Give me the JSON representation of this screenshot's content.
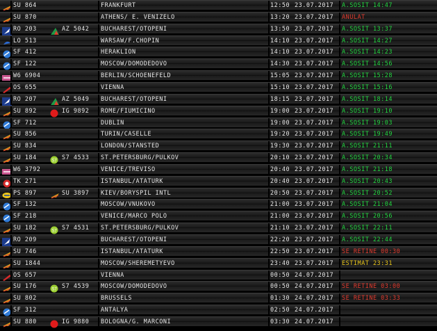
{
  "colors": {
    "status_ok": "#22d640",
    "status_cancel": "#e23b2f",
    "status_delayed": "#e23b2f",
    "status_estimate": "#e7c41a",
    "text": "#e9e9e9"
  },
  "flights": [
    {
      "airline_logo": "aeroflot-icon",
      "code": "SU 864",
      "cs_logo": "",
      "cs_code": "",
      "dest": "FRANKFURT",
      "time": "12:50",
      "date": "23.07.2017",
      "status": "A.SOSIT 14:47",
      "status_type": "ok"
    },
    {
      "airline_logo": "aeroflot-icon",
      "code": "SU 870",
      "cs_logo": "",
      "cs_code": "",
      "dest": "ATHENS/ E. VENIZELO",
      "time": "13:20",
      "date": "23.07.2017",
      "status": "ANULAT",
      "status_type": "cancel"
    },
    {
      "airline_logo": "tarom-icon",
      "code": "RO 203",
      "cs_logo": "alitalia-icon",
      "cs_code": "AZ 5042",
      "dest": "BUCHAREST/OTOPENI",
      "time": "13:50",
      "date": "23.07.2017",
      "status": "A.SOSIT 13:37",
      "status_type": "ok"
    },
    {
      "airline_logo": "lot-icon",
      "code": "LO 513",
      "cs_logo": "",
      "cs_code": "",
      "dest": "WARSAW/F.CHOPIN",
      "time": "14:10",
      "date": "23.07.2017",
      "status": "A.SOSIT 14:27",
      "status_type": "ok"
    },
    {
      "airline_logo": "rossiya-icon",
      "code": "SF 412",
      "cs_logo": "",
      "cs_code": "",
      "dest": "HERAKLION",
      "time": "14:10",
      "date": "23.07.2017",
      "status": "A.SOSIT 14:23",
      "status_type": "ok"
    },
    {
      "airline_logo": "rossiya-icon",
      "code": "SF 122",
      "cs_logo": "",
      "cs_code": "",
      "dest": "MOSCOW/DOMODEDOVO",
      "time": "14:30",
      "date": "23.07.2017",
      "status": "A.SOSIT 14:56",
      "status_type": "ok"
    },
    {
      "airline_logo": "wizzair-icon",
      "code": "W6 6904",
      "cs_logo": "",
      "cs_code": "",
      "dest": "BERLIN/SCHOENEFELD",
      "time": "15:05",
      "date": "23.07.2017",
      "status": "A.SOSIT 15:28",
      "status_type": "ok"
    },
    {
      "airline_logo": "austrian-icon",
      "code": "OS 655",
      "cs_logo": "",
      "cs_code": "",
      "dest": "VIENNA",
      "time": "15:10",
      "date": "23.07.2017",
      "status": "A.SOSIT 15:16",
      "status_type": "ok"
    },
    {
      "airline_logo": "tarom-icon",
      "code": "RO 207",
      "cs_logo": "alitalia-icon",
      "cs_code": "AZ 5049",
      "dest": "BUCHAREST/OTOPENI",
      "time": "18:15",
      "date": "23.07.2017",
      "status": "A.SOSIT 18:14",
      "status_type": "ok"
    },
    {
      "airline_logo": "aeroflot-icon",
      "code": "SU 892",
      "cs_logo": "red-dot-icon",
      "cs_code": "IG 9892",
      "dest": "ROME/FIUMICINO",
      "time": "19:00",
      "date": "23.07.2017",
      "status": "A.SOSIT 19:10",
      "status_type": "ok"
    },
    {
      "airline_logo": "rossiya-icon",
      "code": "SF 712",
      "cs_logo": "",
      "cs_code": "",
      "dest": "DUBLIN",
      "time": "19:00",
      "date": "23.07.2017",
      "status": "A.SOSIT 19:03",
      "status_type": "ok"
    },
    {
      "airline_logo": "aeroflot-icon",
      "code": "SU 856",
      "cs_logo": "",
      "cs_code": "",
      "dest": "TURIN/CASELLE",
      "time": "19:20",
      "date": "23.07.2017",
      "status": "A.SOSIT 19:49",
      "status_type": "ok"
    },
    {
      "airline_logo": "aeroflot-icon",
      "code": "SU 834",
      "cs_logo": "",
      "cs_code": "",
      "dest": "LONDON/STANSTED",
      "time": "19:30",
      "date": "23.07.2017",
      "status": "A.SOSIT 21:11",
      "status_type": "ok"
    },
    {
      "airline_logo": "aeroflot-icon",
      "code": "SU 184",
      "cs_logo": "s7-icon",
      "cs_code": "S7 4533",
      "dest": "ST.PETERSBURG/PULKOV",
      "time": "20:10",
      "date": "23.07.2017",
      "status": "A.SOSIT 20:34",
      "status_type": "ok"
    },
    {
      "airline_logo": "wizzair-icon",
      "code": "W6 3792",
      "cs_logo": "",
      "cs_code": "",
      "dest": "VENICE/TREVISO",
      "time": "20:40",
      "date": "23.07.2017",
      "status": "A.SOSIT 21:18",
      "status_type": "ok"
    },
    {
      "airline_logo": "turkish-icon",
      "code": "TK 271",
      "cs_logo": "",
      "cs_code": "",
      "dest": "ISTANBUL/ATATURK",
      "time": "20:40",
      "date": "23.07.2017",
      "status": "A.SOSIT 20:43",
      "status_type": "ok"
    },
    {
      "airline_logo": "ukraine-intl-icon",
      "code": "PS 897",
      "cs_logo": "aeroflot-icon",
      "cs_code": "SU 3897",
      "dest": "KIEV/BORYSPIL INTL",
      "time": "20:50",
      "date": "23.07.2017",
      "status": "A.SOSIT 20:52",
      "status_type": "ok"
    },
    {
      "airline_logo": "rossiya-icon",
      "code": "SF 132",
      "cs_logo": "",
      "cs_code": "",
      "dest": "MOSCOW/VNUKOVO",
      "time": "21:00",
      "date": "23.07.2017",
      "status": "A.SOSIT 21:04",
      "status_type": "ok"
    },
    {
      "airline_logo": "rossiya-icon",
      "code": "SF 218",
      "cs_logo": "",
      "cs_code": "",
      "dest": "VENICE/MARCO POLO",
      "time": "21:00",
      "date": "23.07.2017",
      "status": "A.SOSIT 20:56",
      "status_type": "ok"
    },
    {
      "airline_logo": "aeroflot-icon",
      "code": "SU 182",
      "cs_logo": "s7-icon",
      "cs_code": "S7 4531",
      "dest": "ST.PETERSBURG/PULKOV",
      "time": "21:10",
      "date": "23.07.2017",
      "status": "A.SOSIT 22:11",
      "status_type": "ok"
    },
    {
      "airline_logo": "tarom-icon",
      "code": "RO 209",
      "cs_logo": "",
      "cs_code": "",
      "dest": "BUCHAREST/OTOPENI",
      "time": "22:20",
      "date": "23.07.2017",
      "status": "A.SOSIT 22:44",
      "status_type": "ok"
    },
    {
      "airline_logo": "aeroflot-icon",
      "code": "SU 746",
      "cs_logo": "",
      "cs_code": "",
      "dest": "ISTANBUL/ATATURK",
      "time": "22:50",
      "date": "23.07.2017",
      "status": "SE RETINE 00:30",
      "status_type": "delayed"
    },
    {
      "airline_logo": "aeroflot-icon",
      "code": "SU 1844",
      "cs_logo": "",
      "cs_code": "",
      "dest": "MOSCOW/SHEREMETYEVO",
      "time": "23:40",
      "date": "23.07.2017",
      "status": "ESTIMAT 23:31",
      "status_type": "estimate"
    },
    {
      "airline_logo": "austrian-icon",
      "code": "OS 657",
      "cs_logo": "",
      "cs_code": "",
      "dest": "VIENNA",
      "time": "00:50",
      "date": "24.07.2017",
      "status": "",
      "status_type": "none"
    },
    {
      "airline_logo": "aeroflot-icon",
      "code": "SU 176",
      "cs_logo": "s7-icon",
      "cs_code": "S7 4539",
      "dest": "MOSCOW/DOMODEDOVO",
      "time": "00:50",
      "date": "24.07.2017",
      "status": "SE RETINE 03:00",
      "status_type": "delayed"
    },
    {
      "airline_logo": "aeroflot-icon",
      "code": "SU 802",
      "cs_logo": "",
      "cs_code": "",
      "dest": "BRUSSELS",
      "time": "01:30",
      "date": "24.07.2017",
      "status": "SE RETINE 03:33",
      "status_type": "delayed"
    },
    {
      "airline_logo": "rossiya-icon",
      "code": "SF 312",
      "cs_logo": "",
      "cs_code": "",
      "dest": "ANTALYA",
      "time": "02:50",
      "date": "24.07.2017",
      "status": "",
      "status_type": "none"
    },
    {
      "airline_logo": "aeroflot-icon",
      "code": "SU 880",
      "cs_logo": "red-dot-icon",
      "cs_code": "IG 9880",
      "dest": "BOLOGNA/G. MARCONI",
      "time": "03:30",
      "date": "24.07.2017",
      "status": "",
      "status_type": "none"
    }
  ]
}
